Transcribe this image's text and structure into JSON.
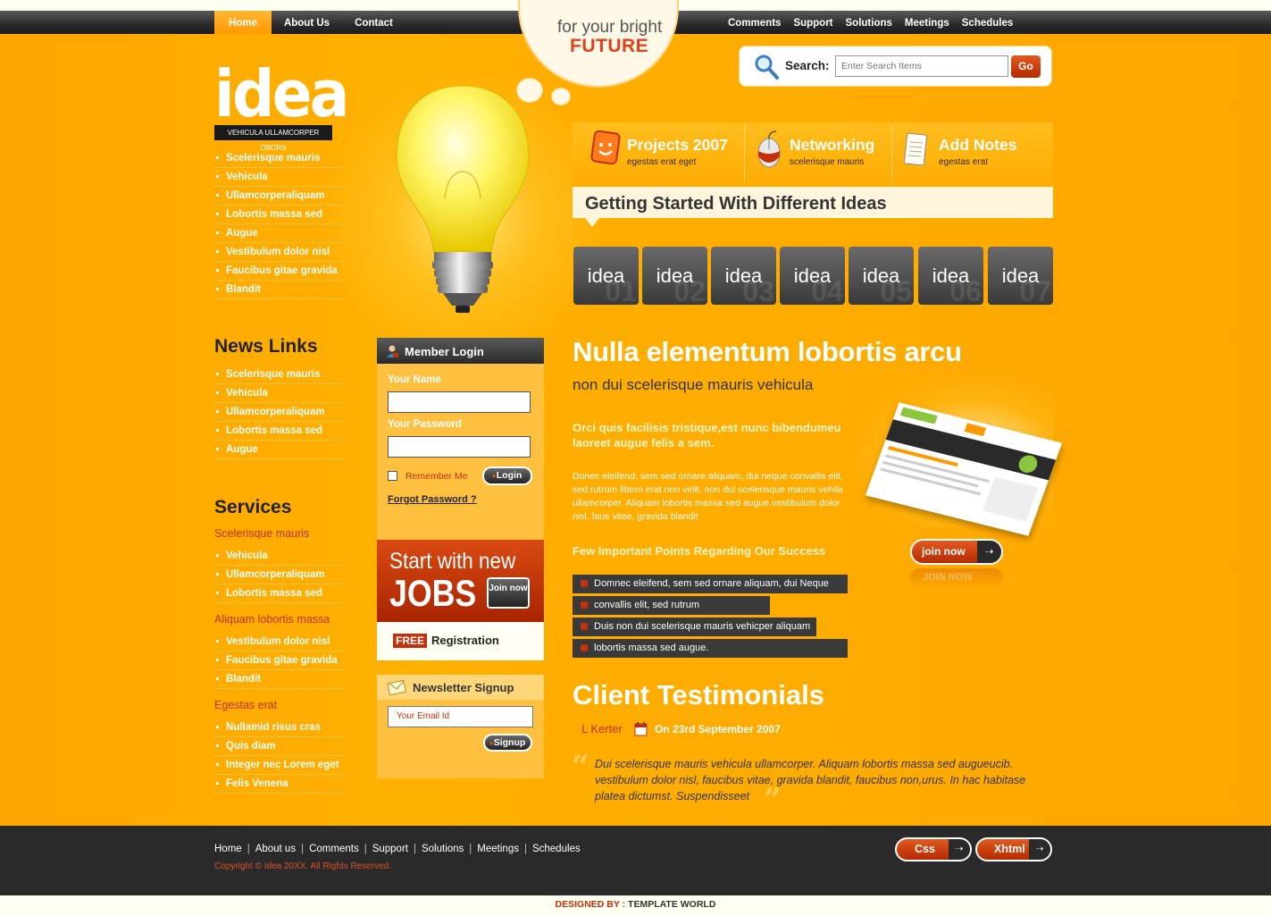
{
  "topnav": {
    "left": [
      {
        "label": "Home",
        "active": true
      },
      {
        "label": "About Us",
        "active": false
      },
      {
        "label": "Contact",
        "active": false
      }
    ],
    "right": [
      "Comments",
      "Support",
      "Solutions",
      "Meetings",
      "Schedules"
    ]
  },
  "cloud": {
    "line1": "for your bright",
    "line2": "FUTURE"
  },
  "logo": {
    "name": "idea",
    "tagline": "VEHICULA ULLAMCORPER OBORS"
  },
  "sidebar": {
    "top_links": [
      "Scelerisque mauris",
      "Vehicula",
      "Ullamcorperaliquam",
      "Lobortis massa sed",
      "Augue",
      "Vestibulum dolor nisl",
      "Faucibus gitae gravida",
      "Blandit"
    ],
    "news_title": "News Links",
    "news_links": [
      "Scelerisque mauris",
      "Vehicula",
      "Ullamcorperaliquam",
      "Lobortis massa sed",
      "Augue"
    ],
    "services_title": "Services",
    "services": [
      {
        "heading": "Scelerisque mauris",
        "items": [
          "Vehicula",
          "Ullamcorperaliquam",
          "Lobortis massa sed"
        ]
      },
      {
        "heading": "Aliquam lobortis massa",
        "items": [
          "Vestibulum dolor nisl",
          "Faucibus gitae gravida",
          "Blandit"
        ]
      },
      {
        "heading": "Egestas erat",
        "items": [
          "Nullamid risus cras",
          "Quis diam",
          "Integer nec Lorem eget",
          "Felis Venena"
        ]
      }
    ]
  },
  "search": {
    "label": "Search:",
    "placeholder": "Enter Search Items",
    "button": "Go"
  },
  "features": [
    {
      "title": "Projects 2007",
      "sub": "egestas erat eget",
      "icon": "smiley-badge-icon"
    },
    {
      "title": "Networking",
      "sub": "scelerisque mauris",
      "icon": "mouse-icon"
    },
    {
      "title": "Add Notes",
      "sub": "egestas erat",
      "icon": "notepad-icon"
    }
  ],
  "getting_started": "Getting Started With Different Ideas",
  "tiles": [
    {
      "label": "idea",
      "num": "01"
    },
    {
      "label": "idea",
      "num": "02"
    },
    {
      "label": "idea",
      "num": "03"
    },
    {
      "label": "idea",
      "num": "04"
    },
    {
      "label": "idea",
      "num": "05"
    },
    {
      "label": "idea",
      "num": "06"
    },
    {
      "label": "idea",
      "num": "07"
    }
  ],
  "login": {
    "title": "Member Login",
    "name_label": "Your Name",
    "password_label": "Your Password",
    "remember": "Remember Me",
    "button": "Login",
    "forgot": "Forgot Password ?"
  },
  "jobs": {
    "line1": "Start with new",
    "line2": "JOBS",
    "join": "Join now",
    "free": "FREE",
    "registration": "Registration"
  },
  "newsletter": {
    "title": "Newsletter Signup",
    "email_placeholder": "Your Email Id",
    "button": "Signup"
  },
  "main": {
    "title": "Nulla elementum lobortis arcu",
    "subtitle": "non dui scelerisque mauris vehicula",
    "intro_bold": "Orci quis facilisis tristique,est nunc bibendumeu laoreet augue felis a sem.",
    "intro_body": "Donec eleifend, sem sed ornare aliquam, dui neque convallis elit, sed rutrum libero erat non velit. non dui scelerisque mauris vehila ullamcorper. Aliquam lobortis massa sed augue.vestibulum dolor nisl, faus vitae, gravida blandit",
    "points_title": "Few Important Points Regarding Our Success",
    "points": [
      "Domnec eleifend, sem sed ornare aliquam, dui Neque",
      "convallis elit, sed rutrum",
      "Duis non dui scelerisque mauris vehicper aliquam",
      "lobortis massa sed augue."
    ],
    "join_button": "join now",
    "join_reflection": "JOIN NOW"
  },
  "testimonials": {
    "title": "Client Testimonials",
    "author": "L Kerter",
    "date": "On 23rd September 2007",
    "quote": "Dui scelerisque mauris vehicula ullamcorper. Aliquam lobortis massa sed augueucib. vestibulum dolor nisl, faucibus vitae, gravida blandit, faucibus non,urus. In hac habitase platea dictumst. Suspendisseet"
  },
  "footer": {
    "links": [
      "Home",
      "About us",
      "Comments",
      "Support",
      "Solutions",
      "Meetings",
      "Schedules"
    ],
    "copyright": "Copyright © Idea 20XX. All Rights Reserved.",
    "css_button": "Css",
    "xhtml_button": "Xhtml"
  },
  "designed_by": {
    "label": "DESIGNED BY :",
    "name": "TEMPLATE WORLD"
  },
  "colors": {
    "orange": "#ffa600",
    "dark": "#2a2a2a",
    "accent_red": "#c4300a"
  }
}
